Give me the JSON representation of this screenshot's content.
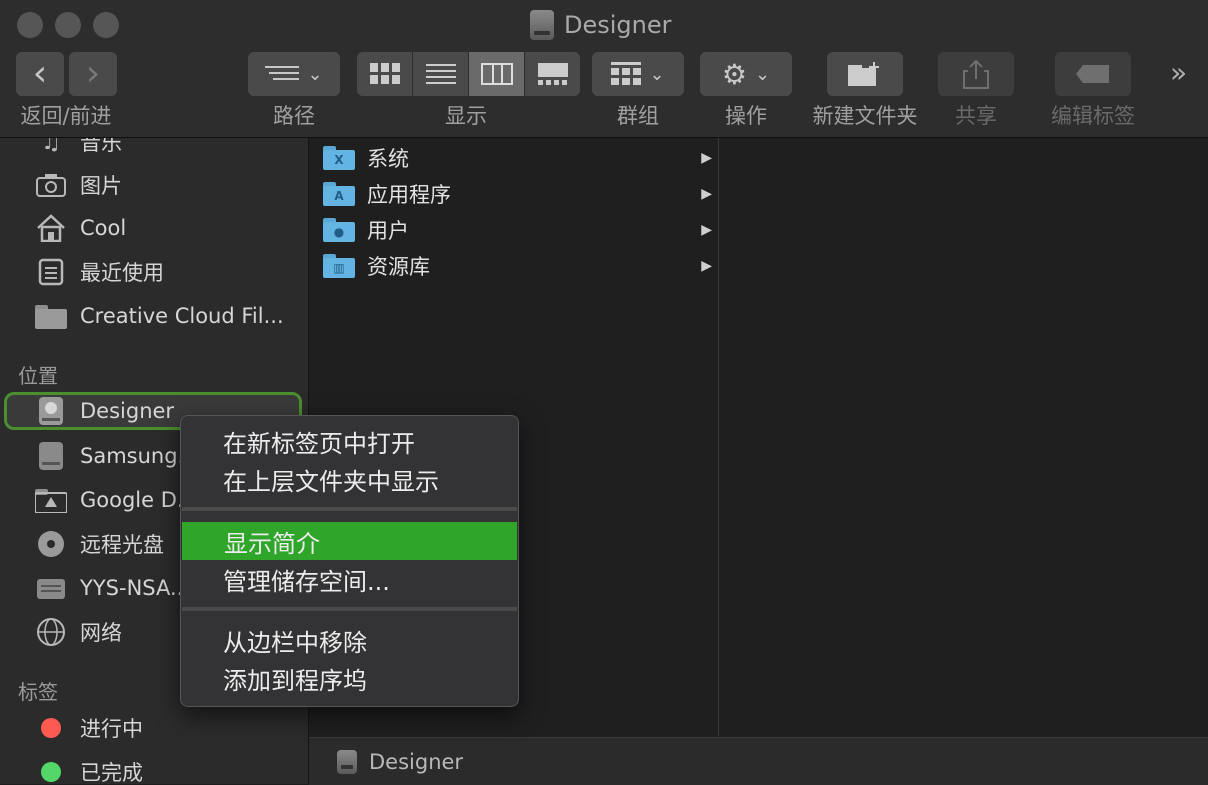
{
  "window": {
    "title": "Designer",
    "traffic_lights": [
      "close",
      "minimize",
      "zoom"
    ]
  },
  "toolbar": {
    "nav_back": "‹",
    "nav_forward": "›",
    "labels": {
      "nav": "返回/前进",
      "path": "路径",
      "view": "显示",
      "group": "群组",
      "action": "操作",
      "new_folder": "新建文件夹",
      "share": "共享",
      "edit_tags": "编辑标签"
    },
    "overflow": "»"
  },
  "sidebar": {
    "top_items": [
      {
        "label": "音乐",
        "icon": "music-icon"
      },
      {
        "label": "图片",
        "icon": "camera-icon"
      },
      {
        "label": "Cool",
        "icon": "home-icon"
      },
      {
        "label": "最近使用",
        "icon": "recents-icon"
      },
      {
        "label": "Creative Cloud Fil...",
        "icon": "folder-icon"
      }
    ],
    "locations_header": "位置",
    "locations": [
      {
        "label": "Designer",
        "icon": "disk-icon",
        "selected": true
      },
      {
        "label": "Samsung...",
        "icon": "drive-icon"
      },
      {
        "label": "Google D...",
        "icon": "google-drive-icon"
      },
      {
        "label": "远程光盘",
        "icon": "disc-icon"
      },
      {
        "label": "YYS-NSA...",
        "icon": "nas-icon"
      },
      {
        "label": "网络",
        "icon": "network-icon"
      }
    ],
    "tags_header": "标签",
    "tags": [
      {
        "label": "进行中",
        "color": "#ff5a52"
      },
      {
        "label": "已完成",
        "color": "#53d769"
      }
    ]
  },
  "column1": {
    "rows": [
      {
        "label": "系统",
        "badge": "X"
      },
      {
        "label": "应用程序",
        "badge": "A"
      },
      {
        "label": "用户",
        "badge": "●"
      },
      {
        "label": "资源库",
        "badge": "▥"
      }
    ]
  },
  "pathbar": {
    "label": "Designer"
  },
  "context_menu": {
    "items": [
      "在新标签页中打开",
      "在上层文件夹中显示",
      "显示简介",
      "管理储存空间...",
      "从边栏中移除",
      "添加到程序坞"
    ],
    "highlighted_index": 2
  },
  "colors": {
    "highlight": "#2fa52a",
    "selection_ring": "#4b8f2e",
    "folder": "#63b3e3"
  }
}
